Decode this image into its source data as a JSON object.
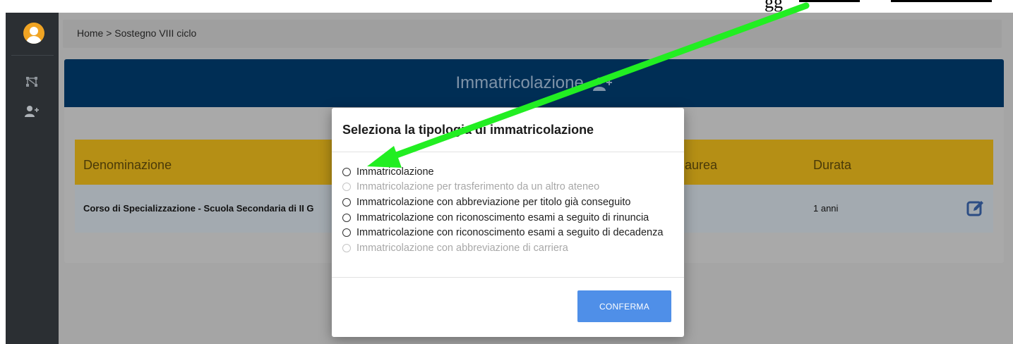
{
  "top_strip": {
    "fragment_text": "gg"
  },
  "breadcrumb": {
    "text": "Home > Sostegno VIII ciclo"
  },
  "card": {
    "title": "Immatricolazione"
  },
  "table": {
    "headers": {
      "denominazione": "Denominazione",
      "laurea": "aurea",
      "durata": "Durata"
    },
    "row": {
      "denominazione": "Corso di Specializzazione - Scuola Secondaria di II G",
      "durata": "1 anni"
    }
  },
  "modal": {
    "title": "Seleziona la tipologia di immatricolazione",
    "options": [
      {
        "label": "Immatricolazione",
        "enabled": true
      },
      {
        "label": "Immatricolazione per trasferimento da un altro ateneo",
        "enabled": false
      },
      {
        "label": "Immatricolazione con abbreviazione per titolo già conseguito",
        "enabled": true
      },
      {
        "label": "Immatricolazione con riconoscimento esami a seguito di rinuncia",
        "enabled": true
      },
      {
        "label": "Immatricolazione con riconoscimento esami a seguito di decadenza",
        "enabled": true
      },
      {
        "label": "Immatricolazione con abbreviazione di carriera",
        "enabled": false
      }
    ],
    "confirm_label": "CONFERMA"
  },
  "icons": {
    "avatar": "user-avatar-icon",
    "network": "network-nodes-icon",
    "add_user": "user-plus-icon",
    "edit": "edit-pencil-icon"
  },
  "colors": {
    "sidebar": "#2b2f33",
    "header_blue": "#002e55",
    "table_header": "#b58f15",
    "confirm_button": "#4f8fe8",
    "annotation_arrow": "#22ee22"
  }
}
